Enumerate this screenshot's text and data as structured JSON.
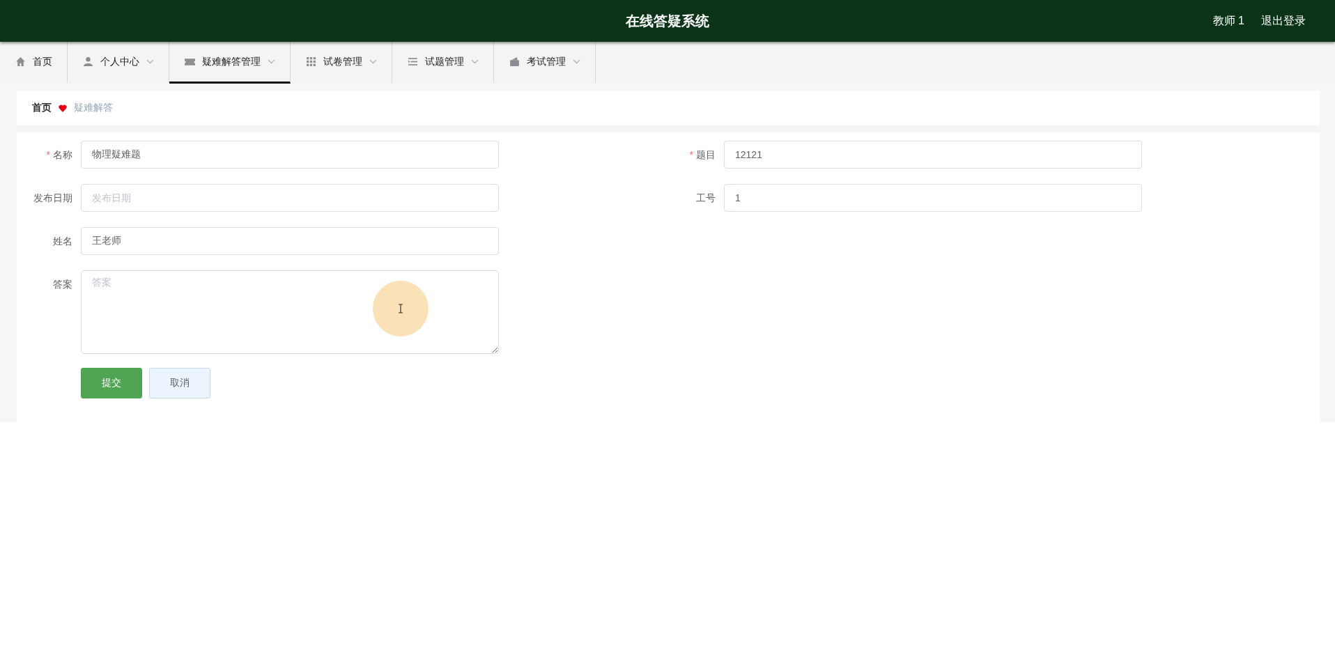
{
  "header": {
    "title": "在线答疑系统",
    "user": "教师 1",
    "logout": "退出登录"
  },
  "nav": [
    {
      "label": "首页",
      "dropdown": false,
      "selected": false
    },
    {
      "label": "个人中心",
      "dropdown": true,
      "selected": false
    },
    {
      "label": "疑难解答管理",
      "dropdown": true,
      "selected": true
    },
    {
      "label": "试卷管理",
      "dropdown": true,
      "selected": false
    },
    {
      "label": "试题管理",
      "dropdown": true,
      "selected": false
    },
    {
      "label": "考试管理",
      "dropdown": true,
      "selected": false
    }
  ],
  "breadcrumb": [
    {
      "label": "首页"
    },
    {
      "label": "疑难解答"
    }
  ],
  "form": {
    "rows": [
      {
        "fields": [
          {
            "kind": "input",
            "label": "名称",
            "required_mark": "*",
            "value": "物理疑难题"
          },
          {
            "kind": "input",
            "label": "题目",
            "required_mark": "*",
            "value": "12121"
          }
        ]
      },
      {
        "fields": [
          {
            "kind": "input",
            "label": "发布日期",
            "placeholder": "发布日期"
          },
          {
            "kind": "input",
            "label": "工号",
            "value": "1"
          }
        ]
      },
      {
        "fields": [
          {
            "kind": "input",
            "label": "姓名",
            "value": "王老师"
          }
        ]
      },
      {
        "fields": [
          {
            "kind": "textarea",
            "label": "答案",
            "placeholder": "答案"
          }
        ]
      }
    ],
    "buttons": [
      {
        "kind": "primary",
        "label": "提交"
      },
      {
        "kind": "plain",
        "label": "取消"
      }
    ]
  }
}
